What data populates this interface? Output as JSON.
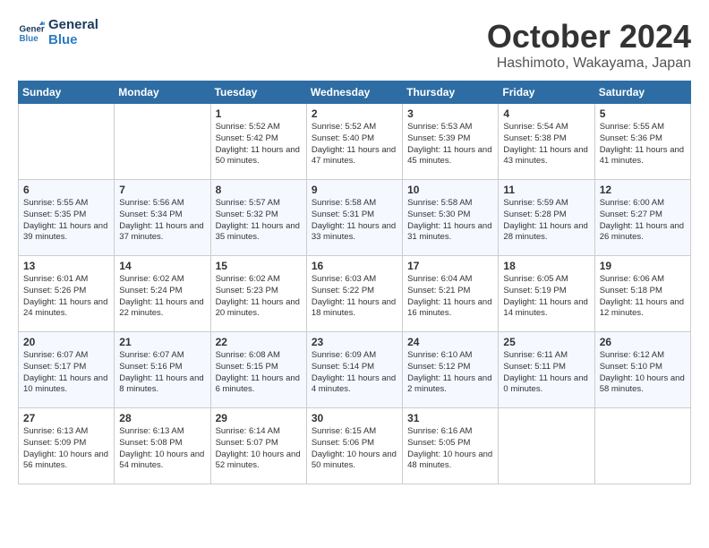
{
  "logo": {
    "line1": "General",
    "line2": "Blue"
  },
  "title": "October 2024",
  "location": "Hashimoto, Wakayama, Japan",
  "days_of_week": [
    "Sunday",
    "Monday",
    "Tuesday",
    "Wednesday",
    "Thursday",
    "Friday",
    "Saturday"
  ],
  "weeks": [
    [
      {
        "day": "",
        "content": ""
      },
      {
        "day": "",
        "content": ""
      },
      {
        "day": "1",
        "content": "Sunrise: 5:52 AM\nSunset: 5:42 PM\nDaylight: 11 hours and 50 minutes."
      },
      {
        "day": "2",
        "content": "Sunrise: 5:52 AM\nSunset: 5:40 PM\nDaylight: 11 hours and 47 minutes."
      },
      {
        "day": "3",
        "content": "Sunrise: 5:53 AM\nSunset: 5:39 PM\nDaylight: 11 hours and 45 minutes."
      },
      {
        "day": "4",
        "content": "Sunrise: 5:54 AM\nSunset: 5:38 PM\nDaylight: 11 hours and 43 minutes."
      },
      {
        "day": "5",
        "content": "Sunrise: 5:55 AM\nSunset: 5:36 PM\nDaylight: 11 hours and 41 minutes."
      }
    ],
    [
      {
        "day": "6",
        "content": "Sunrise: 5:55 AM\nSunset: 5:35 PM\nDaylight: 11 hours and 39 minutes."
      },
      {
        "day": "7",
        "content": "Sunrise: 5:56 AM\nSunset: 5:34 PM\nDaylight: 11 hours and 37 minutes."
      },
      {
        "day": "8",
        "content": "Sunrise: 5:57 AM\nSunset: 5:32 PM\nDaylight: 11 hours and 35 minutes."
      },
      {
        "day": "9",
        "content": "Sunrise: 5:58 AM\nSunset: 5:31 PM\nDaylight: 11 hours and 33 minutes."
      },
      {
        "day": "10",
        "content": "Sunrise: 5:58 AM\nSunset: 5:30 PM\nDaylight: 11 hours and 31 minutes."
      },
      {
        "day": "11",
        "content": "Sunrise: 5:59 AM\nSunset: 5:28 PM\nDaylight: 11 hours and 28 minutes."
      },
      {
        "day": "12",
        "content": "Sunrise: 6:00 AM\nSunset: 5:27 PM\nDaylight: 11 hours and 26 minutes."
      }
    ],
    [
      {
        "day": "13",
        "content": "Sunrise: 6:01 AM\nSunset: 5:26 PM\nDaylight: 11 hours and 24 minutes."
      },
      {
        "day": "14",
        "content": "Sunrise: 6:02 AM\nSunset: 5:24 PM\nDaylight: 11 hours and 22 minutes."
      },
      {
        "day": "15",
        "content": "Sunrise: 6:02 AM\nSunset: 5:23 PM\nDaylight: 11 hours and 20 minutes."
      },
      {
        "day": "16",
        "content": "Sunrise: 6:03 AM\nSunset: 5:22 PM\nDaylight: 11 hours and 18 minutes."
      },
      {
        "day": "17",
        "content": "Sunrise: 6:04 AM\nSunset: 5:21 PM\nDaylight: 11 hours and 16 minutes."
      },
      {
        "day": "18",
        "content": "Sunrise: 6:05 AM\nSunset: 5:19 PM\nDaylight: 11 hours and 14 minutes."
      },
      {
        "day": "19",
        "content": "Sunrise: 6:06 AM\nSunset: 5:18 PM\nDaylight: 11 hours and 12 minutes."
      }
    ],
    [
      {
        "day": "20",
        "content": "Sunrise: 6:07 AM\nSunset: 5:17 PM\nDaylight: 11 hours and 10 minutes."
      },
      {
        "day": "21",
        "content": "Sunrise: 6:07 AM\nSunset: 5:16 PM\nDaylight: 11 hours and 8 minutes."
      },
      {
        "day": "22",
        "content": "Sunrise: 6:08 AM\nSunset: 5:15 PM\nDaylight: 11 hours and 6 minutes."
      },
      {
        "day": "23",
        "content": "Sunrise: 6:09 AM\nSunset: 5:14 PM\nDaylight: 11 hours and 4 minutes."
      },
      {
        "day": "24",
        "content": "Sunrise: 6:10 AM\nSunset: 5:12 PM\nDaylight: 11 hours and 2 minutes."
      },
      {
        "day": "25",
        "content": "Sunrise: 6:11 AM\nSunset: 5:11 PM\nDaylight: 11 hours and 0 minutes."
      },
      {
        "day": "26",
        "content": "Sunrise: 6:12 AM\nSunset: 5:10 PM\nDaylight: 10 hours and 58 minutes."
      }
    ],
    [
      {
        "day": "27",
        "content": "Sunrise: 6:13 AM\nSunset: 5:09 PM\nDaylight: 10 hours and 56 minutes."
      },
      {
        "day": "28",
        "content": "Sunrise: 6:13 AM\nSunset: 5:08 PM\nDaylight: 10 hours and 54 minutes."
      },
      {
        "day": "29",
        "content": "Sunrise: 6:14 AM\nSunset: 5:07 PM\nDaylight: 10 hours and 52 minutes."
      },
      {
        "day": "30",
        "content": "Sunrise: 6:15 AM\nSunset: 5:06 PM\nDaylight: 10 hours and 50 minutes."
      },
      {
        "day": "31",
        "content": "Sunrise: 6:16 AM\nSunset: 5:05 PM\nDaylight: 10 hours and 48 minutes."
      },
      {
        "day": "",
        "content": ""
      },
      {
        "day": "",
        "content": ""
      }
    ]
  ]
}
